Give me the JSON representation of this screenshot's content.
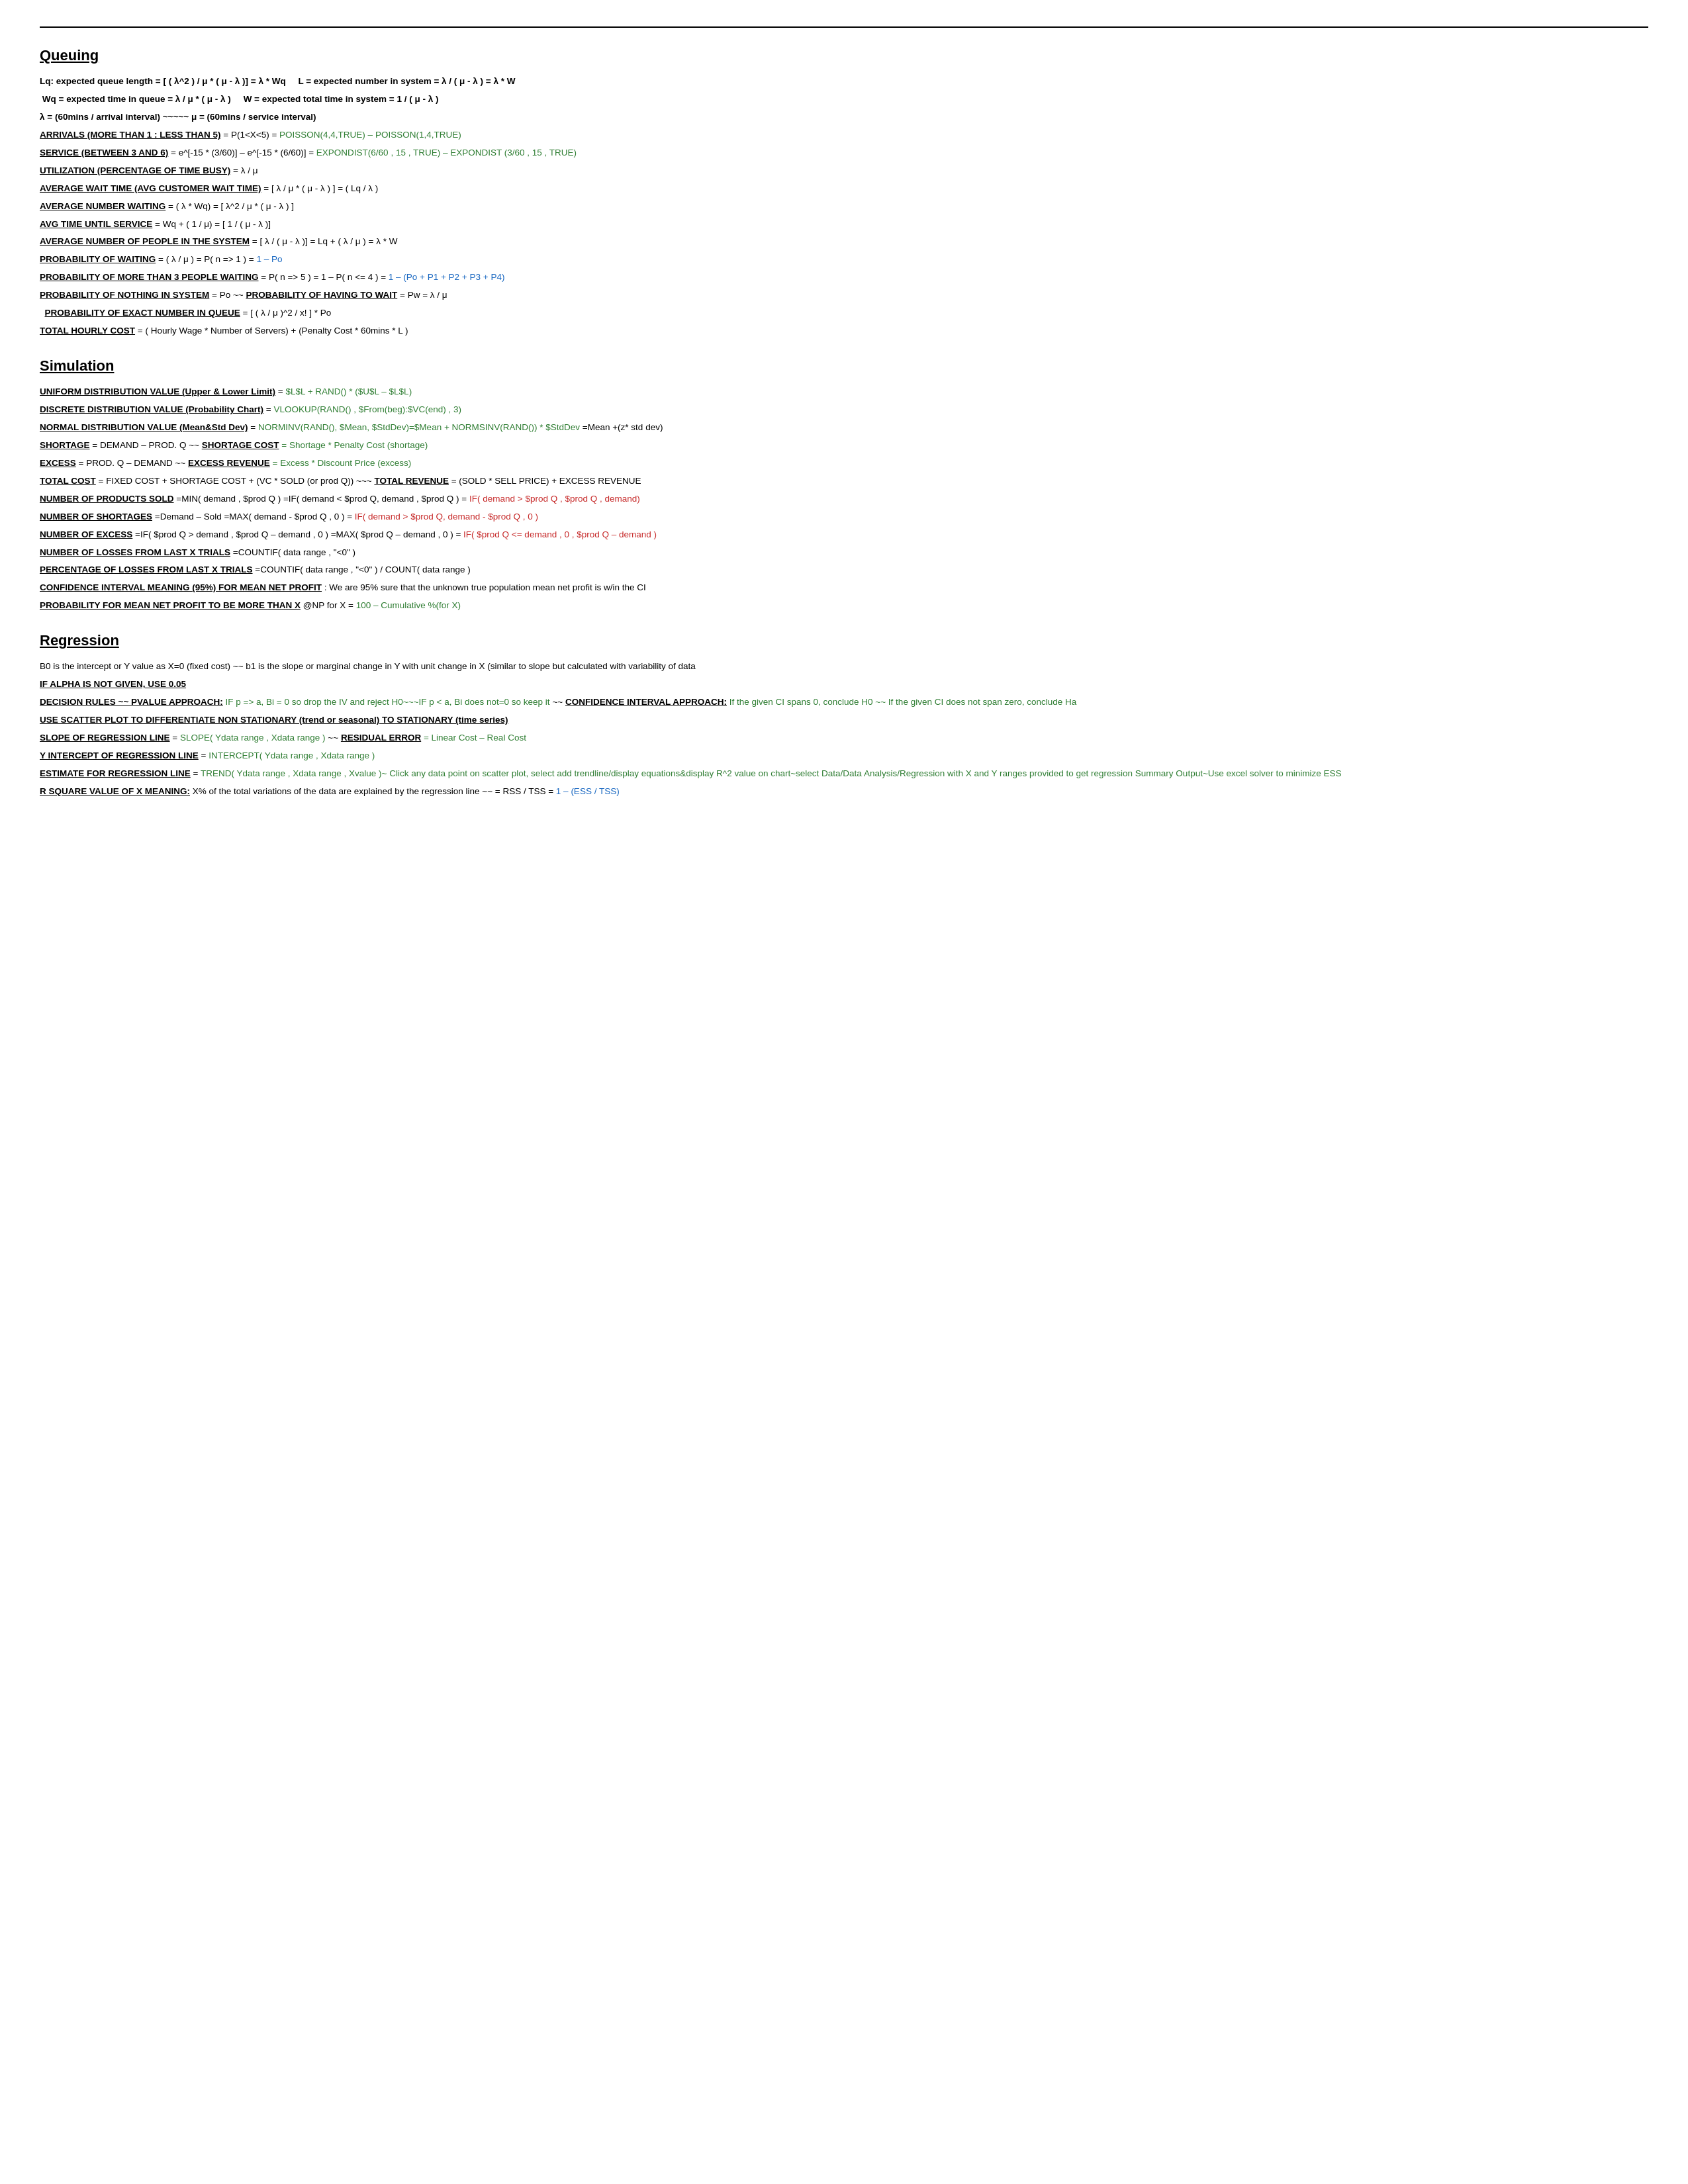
{
  "page": {
    "sections": [
      {
        "id": "queuing",
        "title": "Queuing",
        "lines": []
      },
      {
        "id": "simulation",
        "title": "Simulation",
        "lines": []
      },
      {
        "id": "regression",
        "title": "Regression",
        "lines": []
      }
    ]
  }
}
